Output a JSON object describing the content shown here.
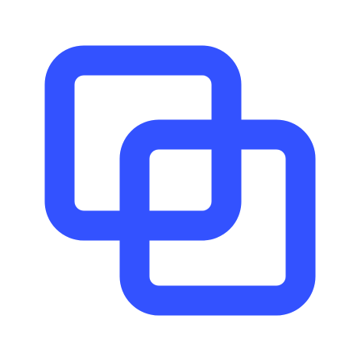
{
  "icon": {
    "name": "overlapping-squares-icon",
    "color": "#3352ff",
    "background": "#ffffff"
  }
}
